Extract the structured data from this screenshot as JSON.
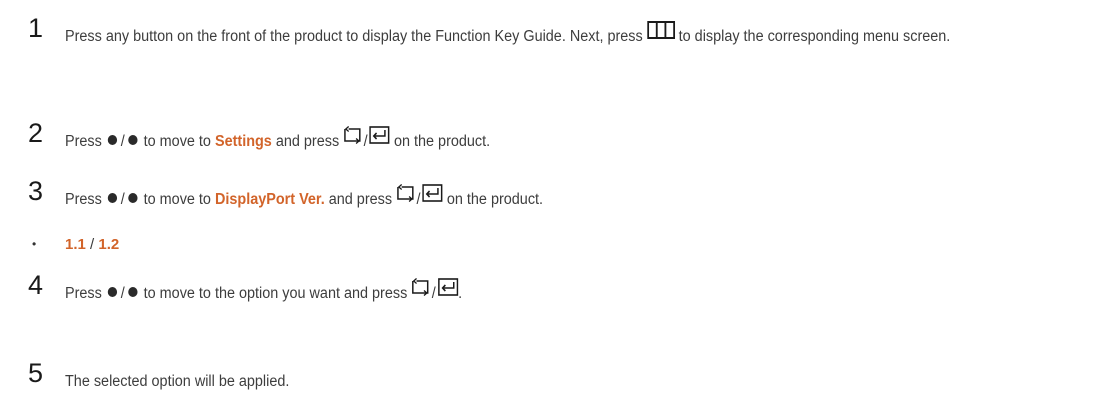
{
  "steps": [
    {
      "number": "1",
      "part1": "Press any button on the front of the product to display the Function Key Guide. Next, press",
      "part2": "to display the corresponding menu screen."
    },
    {
      "number": "2",
      "press": "Press",
      "slash": "/",
      "move_to": "to move to",
      "target": "Settings",
      "and_press": "and press",
      "suffix": "on the product."
    },
    {
      "number": "3",
      "press": "Press",
      "slash": "/",
      "move_to": "to move to",
      "target": "DisplayPort Ver.",
      "and_press": "and press",
      "suffix": "on the product."
    },
    {
      "number": "4",
      "press": "Press",
      "slash": "/",
      "move_to": "to move to the option you want and press",
      "suffix": "."
    },
    {
      "number": "5",
      "text": "The selected option will be applied."
    }
  ],
  "options": {
    "bullet": "•",
    "first": "1.1",
    "separator": "/",
    "second": "1.2"
  },
  "icons": {
    "menu": "menu-grid-icon",
    "dot": "joystick-dot-icon",
    "return": "return-icon",
    "enter": "source-enter-icon"
  },
  "colors": {
    "highlight": "#d2642a",
    "text": "#3d3d3d"
  }
}
